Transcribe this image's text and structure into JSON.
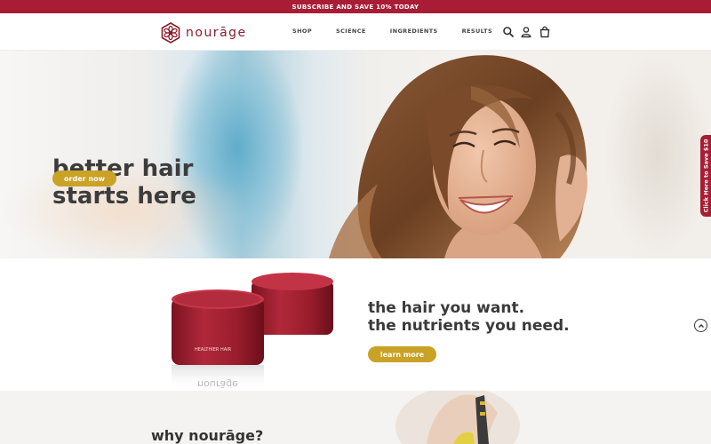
{
  "announcement": {
    "text": "SUBSCRIBE AND SAVE 10% TODAY"
  },
  "header": {
    "brand": "nourāge",
    "nav": [
      "SHOP",
      "SCIENCE",
      "INGREDIENTS",
      "RESULTS"
    ],
    "icons": [
      "search-icon",
      "account-icon",
      "cart-icon"
    ]
  },
  "hero": {
    "title_line1": "better hair",
    "title_line2": "starts here",
    "cta": "order now",
    "side_tab": "Click Here to Save $10"
  },
  "products": {
    "tagline_line1": "the hair you want.",
    "tagline_line2": "the nutrients you need.",
    "cta": "learn more",
    "jar_label": "HEALTHIER HAIR",
    "reflection_text": "nourāge"
  },
  "why": {
    "title": "why nourāge?"
  },
  "colors": {
    "brand_red": "#a81d35",
    "gold": "#c9a227",
    "text_dark": "#3c3c3c"
  }
}
